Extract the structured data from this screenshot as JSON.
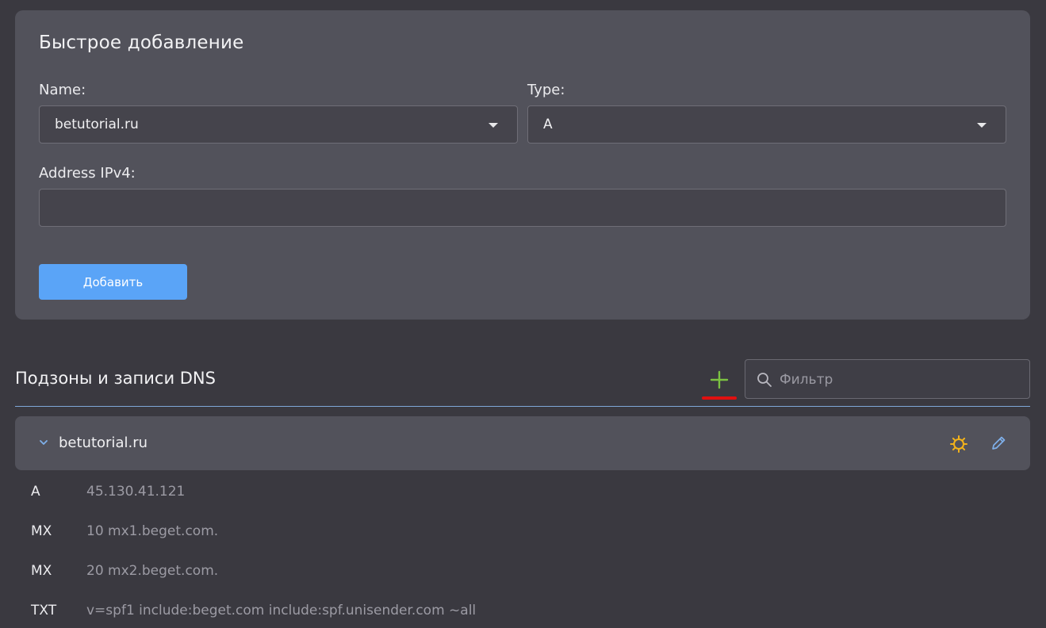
{
  "quick_add": {
    "title": "Быстрое добавление",
    "name_label": "Name:",
    "name_value": "betutorial.ru",
    "type_label": "Type:",
    "type_value": "A",
    "address_label": "Address IPv4:",
    "address_value": "",
    "add_button": "Добавить"
  },
  "records_section": {
    "title": "Подзоны и записи DNS",
    "filter_placeholder": "Фильтр"
  },
  "zone": {
    "name": "betutorial.ru",
    "records": [
      {
        "type": "A",
        "value": "45.130.41.121"
      },
      {
        "type": "MX",
        "value": "10 mx1.beget.com."
      },
      {
        "type": "MX",
        "value": "20 mx2.beget.com."
      },
      {
        "type": "TXT",
        "value": "v=spf1 include:beget.com include:spf.unisender.com ~all"
      }
    ]
  },
  "colors": {
    "background": "#3a3940",
    "card": "#52525b",
    "primary_button": "#5aa4f7",
    "plus_icon": "#7cc242",
    "gear_icon": "#f2b21a",
    "pencil_icon": "#7fb0ea",
    "highlight_mark": "#e01010"
  },
  "icons": [
    "chevron-down-icon",
    "search-icon",
    "plus-icon",
    "gear-icon",
    "pencil-icon"
  ]
}
